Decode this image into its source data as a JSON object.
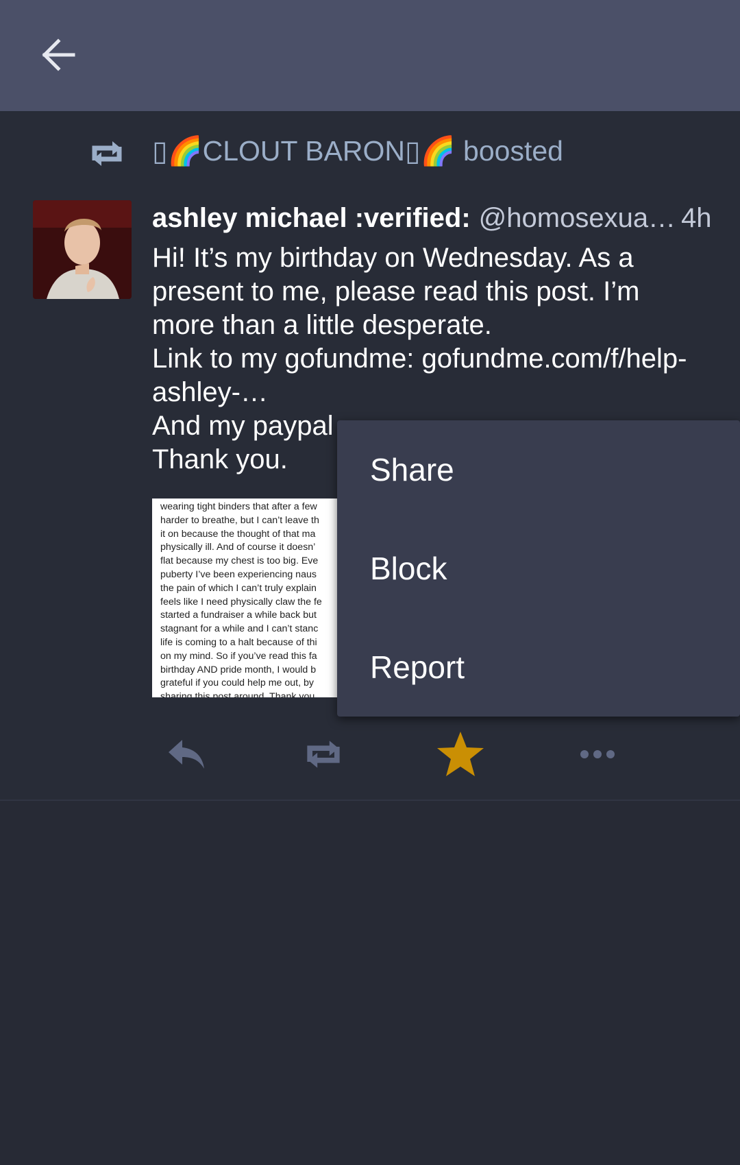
{
  "app_bar": {
    "back_icon": "arrow-left-icon"
  },
  "boost": {
    "booster": "▯🌈CLOUT BARON▯🌈",
    "label": "boosted",
    "icon": "boost-icon"
  },
  "status": {
    "display_name": "ashley michael :verified:",
    "handle": "@homosexua…",
    "time": "4h",
    "body_lines": [
      "Hi! It’s my birthday on Wednesday. As a present to me, please read this post. I’m more than a little desperate.",
      "Link to my gofundme: gofundme.com/f/help-ashley-…",
      "And my paypal",
      "Thank you."
    ],
    "attachment_text": [
      "wearing tight binders that after a few",
      "harder to breathe, but I can’t leave th",
      "it on because the thought of that ma",
      "physically ill. And of course it doesn’",
      "flat because my chest is too big. Eve",
      "puberty I’ve been experiencing naus",
      "the pain of which I can’t truly explain",
      "feels like I need physically claw the fe",
      "started a fundraiser a while back but",
      "stagnant for a while and I can’t stanc",
      "life is coming to a halt because of thi",
      "on my mind. So if you’ve read this fa",
      "birthday AND pride month, I would b",
      "grateful if you could help me out, by",
      "sharing this post around. Thank you"
    ]
  },
  "actions": {
    "reply_icon": "reply-icon",
    "boost_icon": "boost-icon",
    "favourite_icon": "star-icon",
    "more_icon": "more-icon",
    "favourite_color": "#ca8f04",
    "icon_color": "#606984"
  },
  "menu": {
    "items": [
      "Share",
      "Block",
      "Report"
    ]
  },
  "colors": {
    "app_bar": "#4b5068",
    "background": "#282c37",
    "menu": "#393d4f",
    "secondary_text": "#9baec8"
  }
}
